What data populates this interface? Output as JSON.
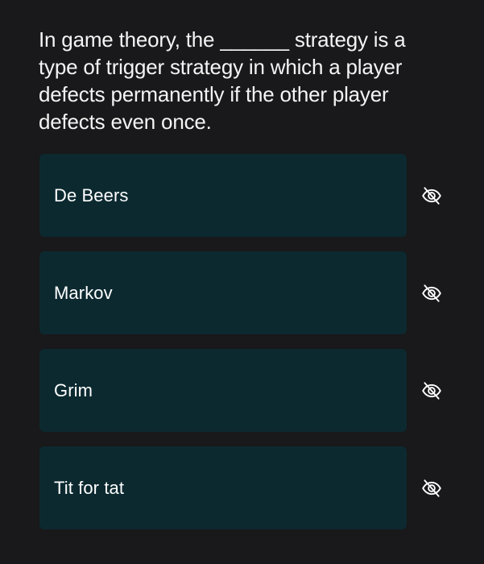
{
  "question": {
    "text": "In game theory, the ______ strategy is a type of trigger strategy in which a player defects permanently if the other player defects even once."
  },
  "options": [
    {
      "label": "De Beers",
      "icon": "eye-slash-icon"
    },
    {
      "label": "Markov",
      "icon": "eye-slash-icon"
    },
    {
      "label": "Grim",
      "icon": "eye-slash-icon"
    },
    {
      "label": "Tit for tat",
      "icon": "eye-slash-icon"
    }
  ],
  "colors": {
    "background": "#19181a",
    "card": "#0c2930",
    "text": "#ffffff",
    "icon": "#ffffff"
  }
}
